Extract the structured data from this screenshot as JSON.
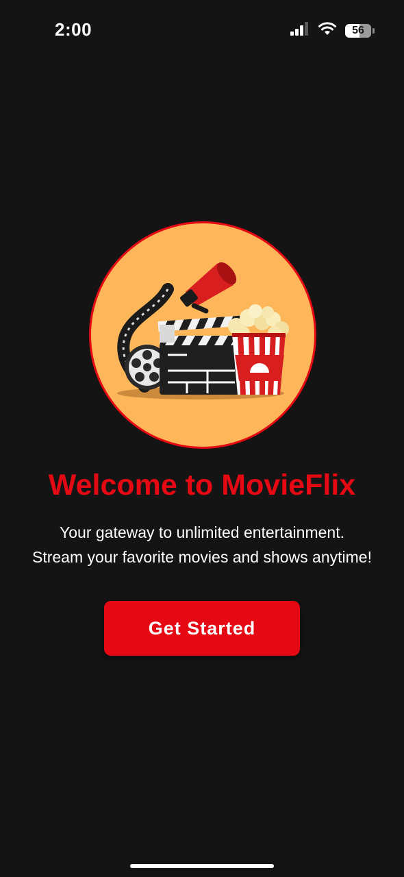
{
  "status_bar": {
    "time": "2:00",
    "battery_level": "56",
    "icons": [
      "signal-icon",
      "wifi-icon",
      "battery-icon"
    ]
  },
  "hero": {
    "image": "movie-clapperboard-popcorn-illustration",
    "icons": [
      "film-reel-icon",
      "megaphone-icon",
      "clapperboard-icon",
      "popcorn-icon"
    ]
  },
  "welcome": {
    "title": "Welcome to MovieFlix",
    "subtitle_line1": "Your gateway to unlimited entertainment.",
    "subtitle_line2": "Stream your favorite movies and shows anytime!"
  },
  "cta": {
    "label": "Get Started"
  },
  "colors": {
    "background": "#141414",
    "accent": "#e50914",
    "hero_fill": "#fdb65a",
    "text": "#ffffff"
  }
}
